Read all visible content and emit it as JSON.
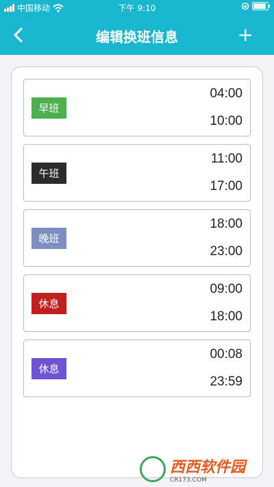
{
  "status": {
    "carrier": "中国移动",
    "time": "下午 9:10"
  },
  "header": {
    "title": "编辑换班信息",
    "add_label": "+"
  },
  "shifts": [
    {
      "label": "早班",
      "start": "04:00",
      "end": "10:00",
      "color": "#4caf50"
    },
    {
      "label": "午班",
      "start": "11:00",
      "end": "17:00",
      "color": "#2b2b2b"
    },
    {
      "label": "晚班",
      "start": "18:00",
      "end": "23:00",
      "color": "#7b8fc0"
    },
    {
      "label": "休息",
      "start": "09:00",
      "end": "18:00",
      "color": "#c0201e"
    },
    {
      "label": "休息",
      "start": "00:08",
      "end": "23:59",
      "color": "#6e54d4"
    }
  ],
  "watermark": {
    "text": "西西软件园",
    "sub": "CR173.COM"
  }
}
